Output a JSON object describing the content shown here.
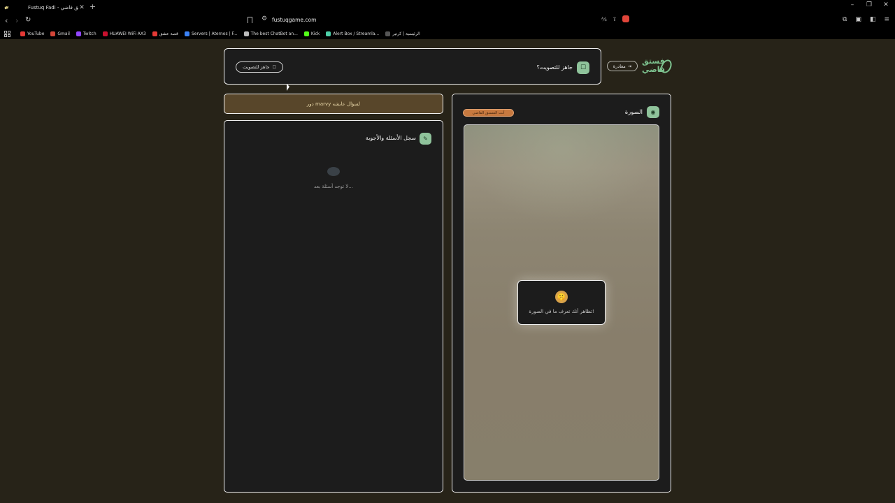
{
  "browser": {
    "tab_title": "Fustuq Fadi - فستق فاضي",
    "tab_close": "✕",
    "new_tab": "+",
    "url": "fustuqgame.com",
    "window_controls": [
      "–",
      "❐",
      "✕"
    ],
    "bookmarks": [
      {
        "label": "YouTube",
        "color": "#e53935"
      },
      {
        "label": "Gmail",
        "color": "#d44638"
      },
      {
        "label": "Twitch",
        "color": "#9146ff"
      },
      {
        "label": "HUAWEI WiFi AX3",
        "color": "#c8102e"
      },
      {
        "label": "قصة عشق",
        "color": "#e53935"
      },
      {
        "label": "Servers | Aternos | F...",
        "color": "#3b82f6"
      },
      {
        "label": "The best ChatBot an...",
        "color": "#bbbbbb"
      },
      {
        "label": "Kick",
        "color": "#53fc18"
      },
      {
        "label": "Alert Box / Streamla...",
        "color": "#4dd0a8"
      },
      {
        "label": "الرئيسية | كرتير",
        "color": "#555555"
      }
    ]
  },
  "header": {
    "logo_text": "فستق فاضي",
    "exit_label": "مغادرة",
    "ready_question": "جاهز للتصويت؟",
    "vote_button_label": "جاهز للتصويت"
  },
  "turn_banner": "دور marvy لسؤال عابشه",
  "qa_panel": {
    "title": "سجل الأسئلة والأجوبة",
    "empty_text": "لا توجد أسئلة بعد..."
  },
  "image_panel": {
    "title": "الصورة",
    "role_badge": "أنت الفستق الفاضي",
    "hint_text": "تظاهر أنك تعرف ما في الصورة!"
  },
  "colors": {
    "page_bg": "#272318",
    "accent_green": "#8fc39b",
    "banner_bg": "#58462a",
    "badge_orange": "#c7793f"
  },
  "icons": {
    "exit": "exit-icon",
    "ready": "ballot-icon",
    "qa": "feather-icon",
    "image": "eye-icon",
    "hint": "shushing-face-icon"
  }
}
